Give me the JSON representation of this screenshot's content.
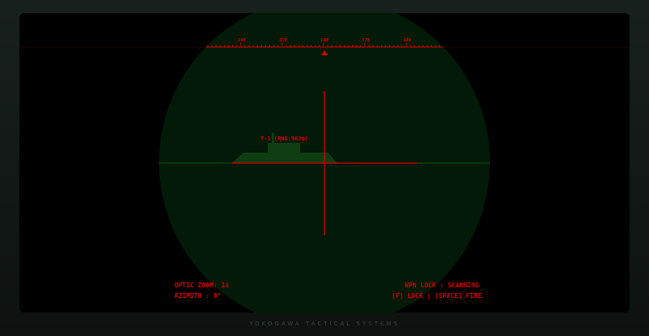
{
  "compass": {
    "labels": [
      "140",
      "150",
      "160",
      "170",
      "180"
    ],
    "marker_value": 160
  },
  "target": {
    "label": "T-1 (RNG:962m)"
  },
  "hud": {
    "zoom_label": "OPTIC ZOOM: 1x",
    "azimuth_label": "AZIMUTH  : 0°",
    "lock_status": "WPN LOCK : SCANNING",
    "controls_hint": "[F] LOCK | [SPACE] FIRE"
  },
  "footer": {
    "brand": "YOKOGAWA TACTICAL SYSTEMS"
  },
  "colors": {
    "scope_bg": "#021a07",
    "reticle": "#e00000",
    "target_fill": "#0e3d12",
    "horizon": "#0f5a12"
  }
}
